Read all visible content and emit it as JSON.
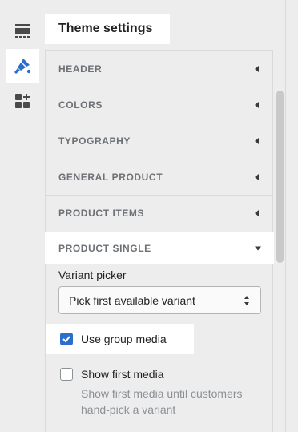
{
  "header": {
    "title": "Theme settings"
  },
  "rail": {
    "items": [
      {
        "icon": "sections-icon",
        "active": false
      },
      {
        "icon": "theme-paintbrush-icon",
        "active": true
      },
      {
        "icon": "add-blocks-icon",
        "active": false
      }
    ]
  },
  "sections": {
    "header": "HEADER",
    "colors": "COLORS",
    "typography": "TYPOGRAPHY",
    "general_product": "GENERAL PRODUCT",
    "product_items": "PRODUCT ITEMS",
    "product_single": "PRODUCT SINGLE"
  },
  "product_single": {
    "variant_picker_label": "Variant picker",
    "variant_picker_value": "Pick first available variant",
    "use_group_media_label": "Use group media",
    "use_group_media_checked": true,
    "show_first_media_label": "Show first media",
    "show_first_media_checked": false,
    "show_first_media_help": "Show first media until customers hand-pick a variant"
  },
  "colors": {
    "accent": "#2c6ecb",
    "rail_bg": "#ededed",
    "muted_text": "#8c9196"
  }
}
